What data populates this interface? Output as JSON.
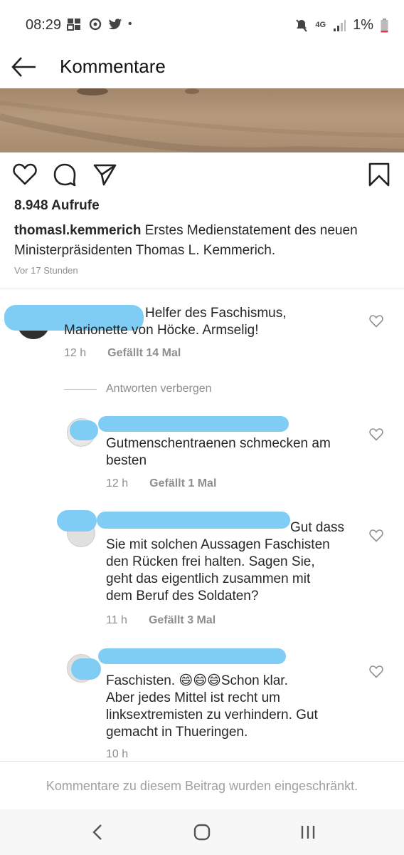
{
  "status_bar": {
    "time": "08:29",
    "network": "4G",
    "battery": "1%"
  },
  "header": {
    "title": "Kommentare"
  },
  "post": {
    "views": "8.948 Aufrufe",
    "username": "thomasl.kemmerich",
    "caption": " Erstes Medienstatement des neuen Ministerpräsidenten Thomas L. Kemmerich.",
    "time": "Vor 17 Stunden"
  },
  "comments": [
    {
      "text_line1": "Helfer des Faschismus,",
      "text_line2": "Marionette von Höcke. Armselig!",
      "time": "12 h",
      "likes": "Gefällt 14 Mal"
    }
  ],
  "hide_replies": "Antworten verbergen",
  "replies": [
    {
      "lines": [
        "Gutmenschentraenen schmecken am",
        "besten"
      ],
      "time": "12 h",
      "likes": "Gefällt 1 Mal"
    },
    {
      "lines": [
        "Gut dass",
        "Sie mit solchen Aussagen Faschisten",
        "den Rücken frei halten. Sagen Sie,",
        "geht das eigentlich zusammen mit",
        "dem Beruf des Soldaten?"
      ],
      "time": "11 h",
      "likes": "Gefällt 3 Mal"
    },
    {
      "lines": [
        "Faschisten. 😄😄😄Schon klar.",
        "Aber jedes Mittel ist recht um",
        "linksextremisten zu verhindern. Gut",
        "gemacht in Thueringen."
      ],
      "time": "10 h",
      "likes": ""
    }
  ],
  "footer": {
    "notice": "Kommentare zu diesem Beitrag wurden eingeschränkt."
  },
  "icons": [
    "back-arrow-icon",
    "heart-icon",
    "comment-icon",
    "share-icon",
    "bookmark-icon",
    "nav-back-icon",
    "nav-home-icon",
    "nav-recents-icon"
  ]
}
